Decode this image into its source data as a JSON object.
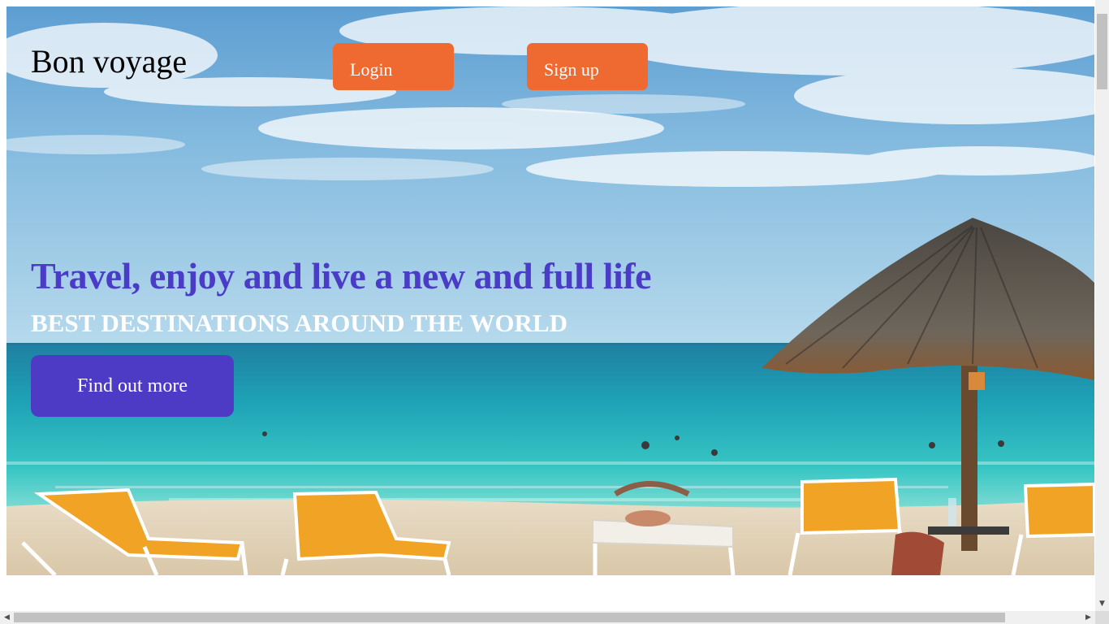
{
  "header": {
    "brand": "Bon voyage",
    "login_label": "Login",
    "signup_label": "Sign up"
  },
  "hero": {
    "headline": "Travel, enjoy and live a new and full life",
    "subheadline": "BEST DESTINATIONS AROUND THE WORLD",
    "cta_label": "Find out more",
    "background_image": "tropical-beach-umbrella-lounge-chairs"
  },
  "colors": {
    "nav_button": "#ee6a30",
    "headline": "#4b3cc7",
    "cta_button": "#4d3bc6",
    "subheadline": "#ffffff"
  },
  "icons": {
    "scroll_down": "▼",
    "scroll_left": "◀",
    "scroll_right": "▶"
  }
}
